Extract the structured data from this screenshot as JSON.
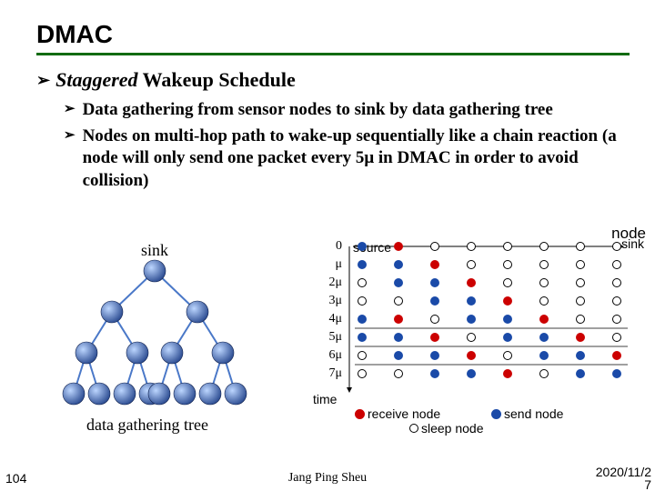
{
  "title": "DMAC",
  "heading": {
    "staggered": "Staggered",
    "rest": " Wakeup Schedule"
  },
  "bullets": [
    "Data gathering from sensor nodes to sink by data gathering tree",
    "Nodes on multi-hop path to wake-up sequentially like a chain reaction (a node will only send one packet every 5μ in DMAC in order to avoid collision)"
  ],
  "tree": {
    "sink_label": "sink",
    "caption": "data gathering tree"
  },
  "schedule": {
    "top_left_label_x": "source",
    "top_right_axis": "node",
    "sink_label": "sink",
    "time_axis": "time",
    "row_labels": [
      "0",
      "μ",
      "2μ",
      "3μ",
      "4μ",
      "5μ",
      "6μ",
      "7μ"
    ],
    "legend": {
      "receive": "receive node",
      "send": "send node",
      "sleep": "sleep node"
    }
  },
  "footer": {
    "left": "104",
    "center": "Jang Ping Sheu",
    "right_top": "2020/11/2",
    "right_bot": "7"
  },
  "chart_data": {
    "type": "table",
    "description": "Staggered wakeup schedule grid. Rows = time slots (0 to 7μ). Columns = 8 nodes from source (col 0) to sink (col 7). Each cell shows node state at that time: send (blue filled), receive (red filled), or sleep (open circle). Data-gathering tree has 8 leaf sensors → 4 mid nodes → 2 upper nodes → 1 sink.",
    "row_labels": [
      "0",
      "μ",
      "2μ",
      "3μ",
      "4μ",
      "5μ",
      "6μ",
      "7μ"
    ],
    "col_ids": [
      0,
      1,
      2,
      3,
      4,
      5,
      6,
      7
    ],
    "states_legend": {
      "B": "send",
      "R": "receive",
      "O": "sleep"
    },
    "grid": [
      [
        "B",
        "R",
        "O",
        "O",
        "O",
        "O",
        "O",
        "O"
      ],
      [
        "B",
        "B",
        "R",
        "O",
        "O",
        "O",
        "O",
        "O"
      ],
      [
        "O",
        "B",
        "B",
        "R",
        "O",
        "O",
        "O",
        "O"
      ],
      [
        "O",
        "O",
        "B",
        "B",
        "R",
        "O",
        "O",
        "O"
      ],
      [
        "B",
        "R",
        "O",
        "B",
        "B",
        "R",
        "O",
        "O"
      ],
      [
        "B",
        "B",
        "R",
        "O",
        "B",
        "B",
        "R",
        "O"
      ],
      [
        "O",
        "B",
        "B",
        "R",
        "O",
        "B",
        "B",
        "R"
      ],
      [
        "O",
        "O",
        "B",
        "B",
        "R",
        "O",
        "B",
        "B"
      ]
    ],
    "tree_structure": {
      "root": "sink",
      "levels": [
        {
          "count": 1
        },
        {
          "count": 2
        },
        {
          "count": 4
        },
        {
          "count": 8
        }
      ]
    }
  }
}
